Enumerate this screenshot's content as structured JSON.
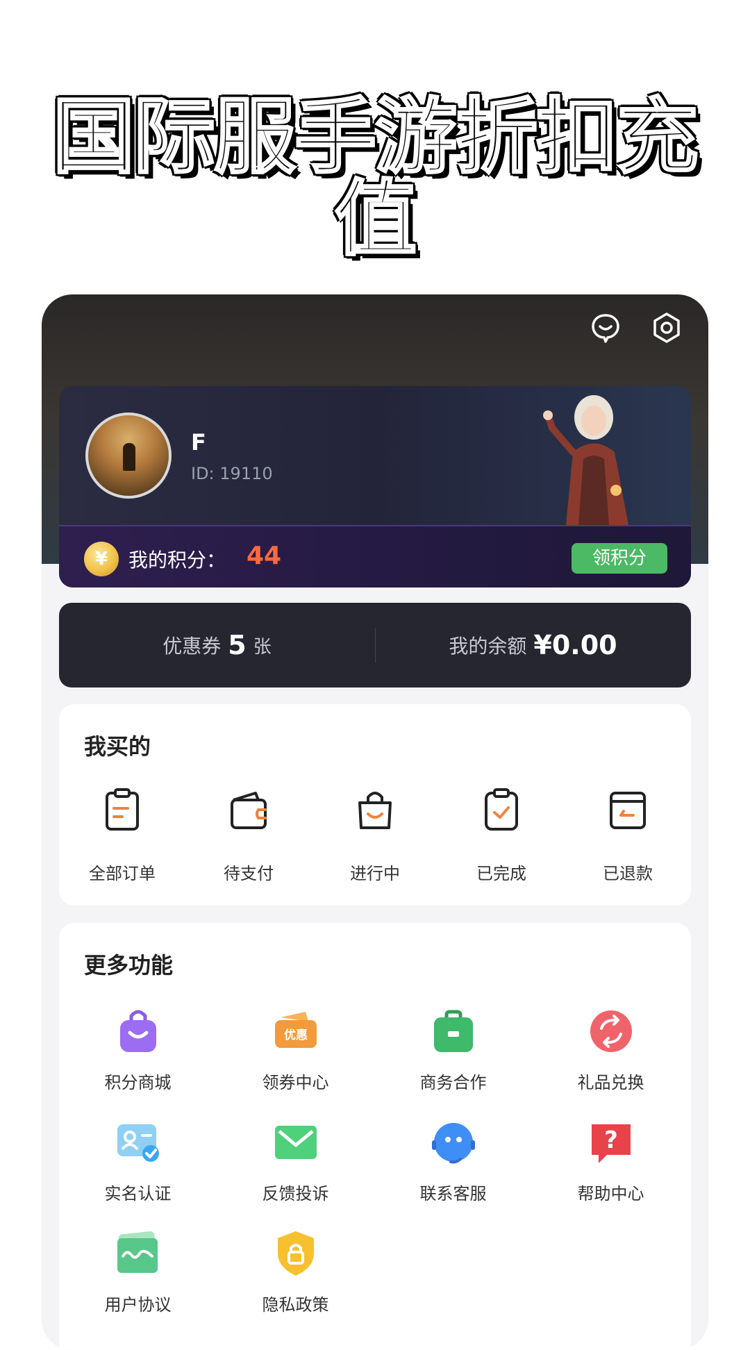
{
  "banner": {
    "title": "国际服手游折扣充值"
  },
  "profile": {
    "username": "F",
    "id_text": "ID: 19110",
    "points_label": "我的积分：",
    "points_value": "44",
    "points_button": "领积分",
    "coin_symbol": "¥"
  },
  "wallet": {
    "coupon_label": "优惠券",
    "coupon_count": "5",
    "coupon_unit": "张",
    "balance_label": "我的余额",
    "balance_value": "¥0.00"
  },
  "orders": {
    "title": "我买的",
    "items": [
      {
        "label": "全部订单",
        "icon": "clipboard-icon"
      },
      {
        "label": "待支付",
        "icon": "wallet-icon"
      },
      {
        "label": "进行中",
        "icon": "shopping-bag-icon"
      },
      {
        "label": "已完成",
        "icon": "clipboard-check-icon"
      },
      {
        "label": "已退款",
        "icon": "refund-icon"
      }
    ]
  },
  "more": {
    "title": "更多功能",
    "items": [
      {
        "label": "积分商城",
        "icon": "points-mall-icon"
      },
      {
        "label": "领券中心",
        "icon": "coupon-center-icon",
        "icon_text": "优惠"
      },
      {
        "label": "商务合作",
        "icon": "briefcase-icon"
      },
      {
        "label": "礼品兑换",
        "icon": "gift-exchange-icon"
      },
      {
        "label": "实名认证",
        "icon": "id-verify-icon"
      },
      {
        "label": "反馈投诉",
        "icon": "mail-icon"
      },
      {
        "label": "联系客服",
        "icon": "customer-service-icon"
      },
      {
        "label": "帮助中心",
        "icon": "help-icon",
        "icon_text": "?"
      },
      {
        "label": "用户协议",
        "icon": "agreement-icon"
      },
      {
        "label": "隐私政策",
        "icon": "privacy-shield-icon"
      }
    ]
  },
  "colors": {
    "accent_orange": "#ff6a3c",
    "points_button_green": "#4cb964",
    "order_icon_accent": "#f0823c"
  }
}
